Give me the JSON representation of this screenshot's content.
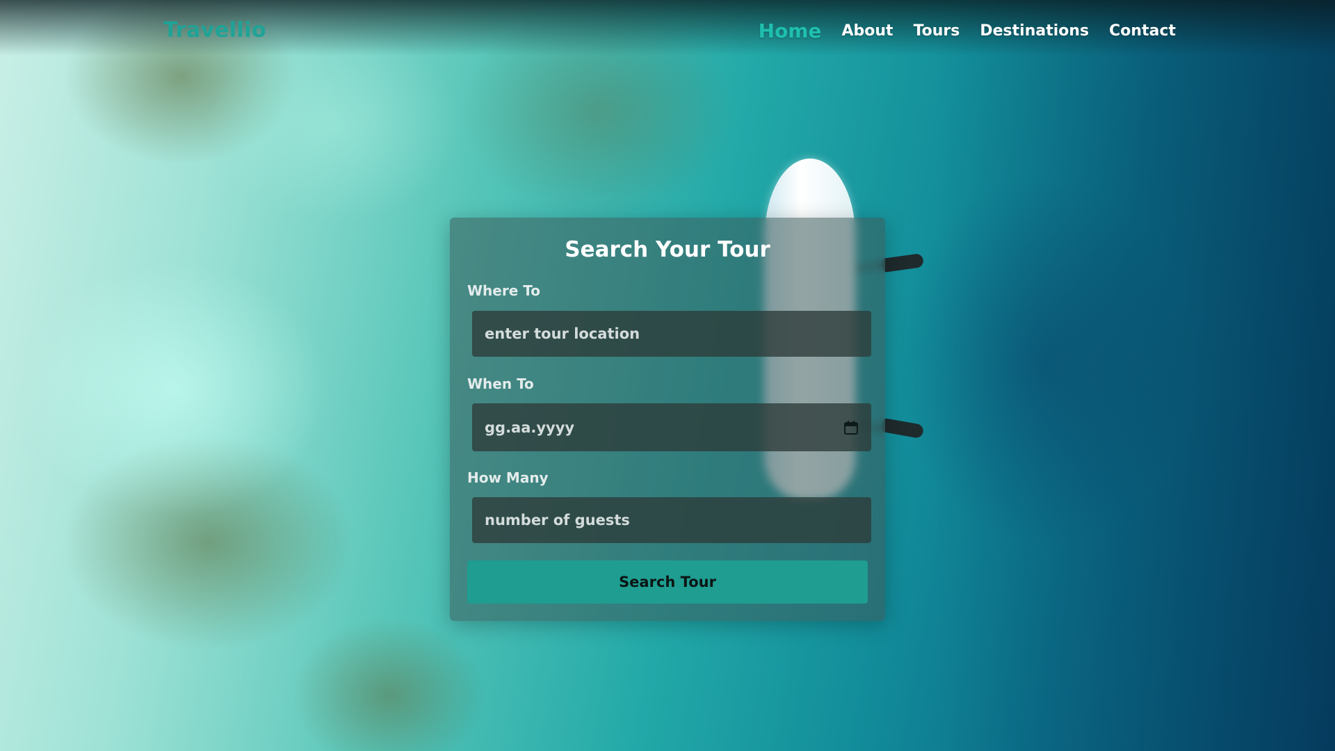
{
  "brand": {
    "name": "Travellio"
  },
  "nav": {
    "links": [
      {
        "label": "Home",
        "active": true
      },
      {
        "label": "About",
        "active": false
      },
      {
        "label": "Tours",
        "active": false
      },
      {
        "label": "Destinations",
        "active": false
      },
      {
        "label": "Contact",
        "active": false
      }
    ]
  },
  "search": {
    "title": "Search Your Tour",
    "where": {
      "label": "Where To",
      "placeholder": "enter tour location",
      "value": ""
    },
    "when": {
      "label": "When To",
      "placeholder": "gg.aa.yyyy",
      "value": "",
      "icon": "calendar-icon"
    },
    "guests": {
      "label": "How Many",
      "placeholder": "number of guests",
      "value": ""
    },
    "button_label": "Search Tour"
  },
  "colors": {
    "brand": "#1fa396",
    "accent": "#1f9d91",
    "active_nav": "#1fbfae"
  }
}
